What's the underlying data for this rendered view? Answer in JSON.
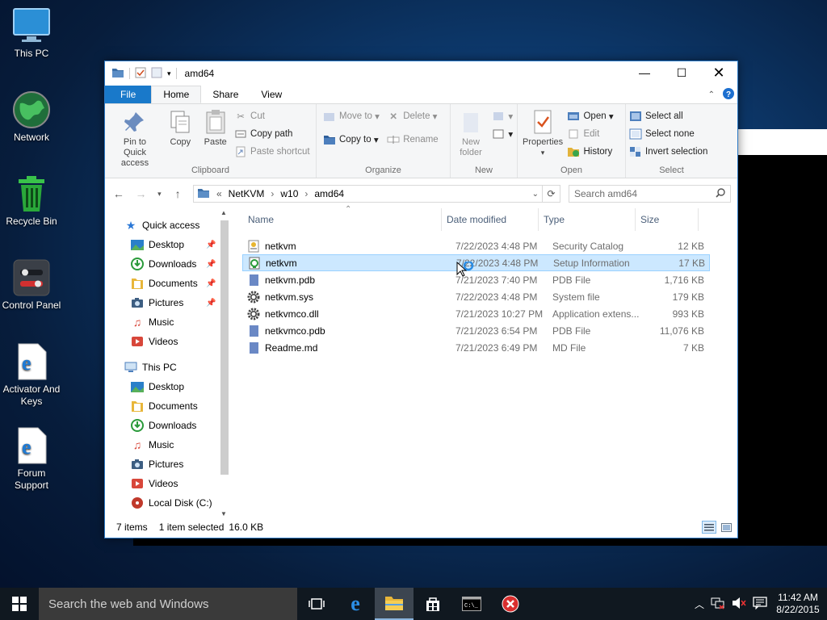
{
  "desktop": {
    "icons": [
      {
        "label": "This PC",
        "icon": "monitor-icon"
      },
      {
        "label": "Network",
        "icon": "globe-icon"
      },
      {
        "label": "Recycle Bin",
        "icon": "recycle-bin-icon"
      },
      {
        "label": "Control Panel",
        "icon": "control-panel-icon"
      },
      {
        "label": "Activator And Keys",
        "icon": "edge-icon"
      },
      {
        "label": "Forum Support",
        "icon": "edge-icon"
      }
    ]
  },
  "window": {
    "title": "amd64",
    "tabs": {
      "file": "File",
      "home": "Home",
      "share": "Share",
      "view": "View"
    },
    "ribbon": {
      "clipboard": {
        "label": "Clipboard",
        "pin": "Pin to Quick access",
        "copy": "Copy",
        "paste": "Paste",
        "cut": "Cut",
        "copy_path": "Copy path",
        "paste_shortcut": "Paste shortcut"
      },
      "organize": {
        "label": "Organize",
        "move_to": "Move to",
        "copy_to": "Copy to",
        "delete": "Delete",
        "rename": "Rename"
      },
      "new": {
        "label": "New",
        "new_folder": "New folder"
      },
      "open": {
        "label": "Open",
        "properties": "Properties",
        "open": "Open",
        "edit": "Edit",
        "history": "History"
      },
      "select": {
        "label": "Select",
        "select_all": "Select all",
        "select_none": "Select none",
        "invert": "Invert selection"
      }
    },
    "address": {
      "prefix": "«",
      "crumbs": [
        "NetKVM",
        "w10",
        "amd64"
      ],
      "search_placeholder": "Search amd64"
    },
    "nav": {
      "quick_access": "Quick access",
      "quick_items": [
        "Desktop",
        "Downloads",
        "Documents",
        "Pictures",
        "Music",
        "Videos"
      ],
      "this_pc": "This PC",
      "pc_items": [
        "Desktop",
        "Documents",
        "Downloads",
        "Music",
        "Pictures",
        "Videos",
        "Local Disk (C:)"
      ]
    },
    "columns": {
      "name": "Name",
      "date": "Date modified",
      "type": "Type",
      "size": "Size"
    },
    "files": [
      {
        "name": "netkvm",
        "date": "7/22/2023 4:48 PM",
        "type": "Security Catalog",
        "size": "12 KB",
        "icon": "catalog-icon"
      },
      {
        "name": "netkvm",
        "date": "7/22/2023 4:48 PM",
        "type": "Setup Information",
        "size": "17 KB",
        "icon": "setup-info-icon"
      },
      {
        "name": "netkvm.pdb",
        "date": "7/21/2023 7:40 PM",
        "type": "PDB File",
        "size": "1,716 KB",
        "icon": "file-icon"
      },
      {
        "name": "netkvm.sys",
        "date": "7/22/2023 4:48 PM",
        "type": "System file",
        "size": "179 KB",
        "icon": "gear-icon"
      },
      {
        "name": "netkvmco.dll",
        "date": "7/21/2023 10:27 PM",
        "type": "Application extens...",
        "size": "993 KB",
        "icon": "gear-icon"
      },
      {
        "name": "netkvmco.pdb",
        "date": "7/21/2023 6:54 PM",
        "type": "PDB File",
        "size": "11,076 KB",
        "icon": "file-icon"
      },
      {
        "name": "Readme.md",
        "date": "7/21/2023 6:49 PM",
        "type": "MD File",
        "size": "7 KB",
        "icon": "file-icon"
      }
    ],
    "status": {
      "items": "7 items",
      "selected": "1 item selected",
      "size": "16.0 KB"
    }
  },
  "taskbar": {
    "search": "Search the web and Windows",
    "time": "11:42 AM",
    "date": "8/22/2015"
  }
}
